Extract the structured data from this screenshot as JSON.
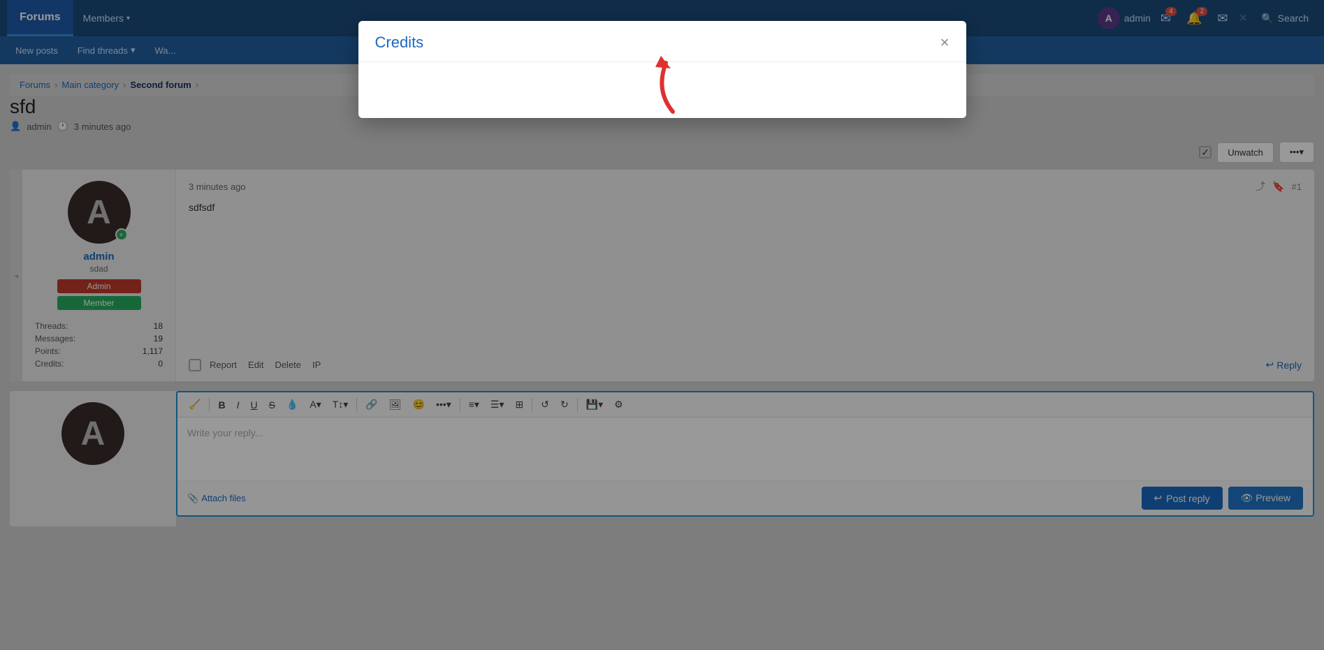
{
  "navbar": {
    "brand": "Forums",
    "items": [
      {
        "label": "Members",
        "has_dropdown": true
      }
    ],
    "user": {
      "name": "admin",
      "avatar_letter": "A"
    },
    "badges": {
      "notifications": "4",
      "alerts": "2"
    },
    "search_label": "Search"
  },
  "subnav": {
    "items": [
      {
        "label": "New posts",
        "has_dropdown": false
      },
      {
        "label": "Find threads",
        "has_dropdown": true
      },
      {
        "label": "Wa..."
      }
    ]
  },
  "breadcrumb": {
    "items": [
      {
        "label": "Forums",
        "active": false
      },
      {
        "label": "Main category",
        "active": false
      },
      {
        "label": "Second forum",
        "active": true
      }
    ]
  },
  "thread": {
    "title": "sfd",
    "author": "admin",
    "time": "3 minutes ago",
    "unwatch_label": "Unwatch"
  },
  "post": {
    "time": "3 minutes ago",
    "text": "sdfsdf",
    "post_num": "#1",
    "author": {
      "name": "admin",
      "title": "sdad",
      "role_admin": "Admin",
      "role_member": "Member",
      "avatar_letter": "A",
      "stats": {
        "threads_label": "Threads:",
        "threads_val": "18",
        "messages_label": "Messages:",
        "messages_val": "19",
        "points_label": "Points:",
        "points_val": "1,117",
        "credits_label": "Credits:",
        "credits_val": "0"
      }
    },
    "actions": {
      "report": "Report",
      "edit": "Edit",
      "delete": "Delete",
      "ip": "IP",
      "reply": "Reply"
    }
  },
  "editor": {
    "placeholder": "Write your reply...",
    "attach_label": "Attach files",
    "post_reply_label": "Post reply",
    "preview_label": "Preview"
  },
  "modal": {
    "title": "Credits",
    "close_icon": "×"
  },
  "toolbar_icons": {
    "eraser": "🧹",
    "bold": "B",
    "italic": "I",
    "underline": "U",
    "strikethrough": "S",
    "highlight": "💧",
    "font_color": "A",
    "font_size": "T↕",
    "link": "🔗",
    "image": "🖼",
    "emoji": "😊",
    "more": "•••",
    "align": "≡",
    "list": "☰",
    "table": "⊞",
    "undo": "↺",
    "redo": "↻",
    "save": "💾",
    "settings": "⚙"
  }
}
